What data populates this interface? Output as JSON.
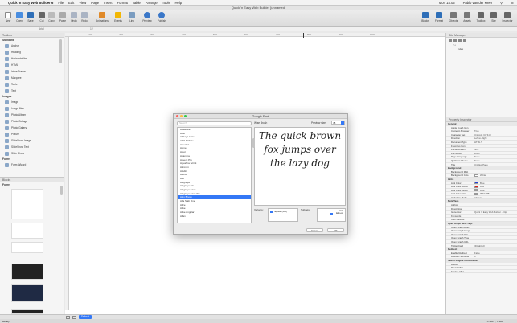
{
  "menubar": {
    "app_name": "Quick 'n Easy Web Builder 6",
    "items": [
      "File",
      "Edit",
      "View",
      "Page",
      "Insert",
      "Format",
      "Table",
      "Arrange",
      "Tools",
      "Help"
    ],
    "clock": "Mon 14:05",
    "user": "Pablo van der Meer"
  },
  "window": {
    "title": "Quick 'n Easy Web Builder [unnamed]"
  },
  "toolbar": {
    "left": [
      "New",
      "Open",
      "Save",
      "Cut",
      "Copy",
      "Paste",
      "Undo",
      "Redo",
      "Animations",
      "Events",
      "Link",
      "Preview",
      "Publish"
    ],
    "right": [
      "Blocks",
      "Format",
      "Objects",
      "Assets",
      "Toolbox",
      "Site",
      "Inspector"
    ]
  },
  "formatbar": {
    "font": "Arial",
    "size": "12"
  },
  "toolbox": {
    "header": "Toolbox",
    "groups": [
      {
        "name": "Standard",
        "items": [
          "Anchor",
          "Heading",
          "Horizontal line",
          "HTML",
          "Inline Frame",
          "Marquee",
          "Table",
          "Text"
        ]
      },
      {
        "name": "Images",
        "items": [
          "Image",
          "Image Map",
          "Photo Album",
          "Photo Collage",
          "Photo Gallery",
          "Picture",
          "SlideShow Image",
          "SlideShow Text",
          "Slide Show"
        ]
      },
      {
        "name": "Forms",
        "items": [
          "Form Wizard"
        ]
      }
    ]
  },
  "blocks": {
    "header": "Blocks",
    "group": "Forms"
  },
  "ruler": [
    "100",
    "200",
    "300",
    "400",
    "500",
    "600",
    "700",
    "800",
    "900",
    "1000"
  ],
  "site_manager": {
    "header": "Site Manager",
    "pages": [
      "index"
    ]
  },
  "inspector": {
    "header": "Property Inspector",
    "rows": [
      {
        "cat": "General"
      },
      {
        "k": "Apple Touch Icon",
        "v": ""
      },
      {
        "k": "Center in Browser",
        "v": "True"
      },
      {
        "k": "Character Set",
        "v": "Unicode (UTF-8)"
      },
      {
        "k": "Direction",
        "v": "Left-to-Right"
      },
      {
        "k": "Document Type",
        "v": "HTML 5"
      },
      {
        "k": "Favorites Icon",
        "v": ""
      },
      {
        "k": "File Extension",
        "v": "html"
      },
      {
        "k": "File Name",
        "v": "index"
      },
      {
        "k": "Page Language",
        "v": "None"
      },
      {
        "k": "Quirks or Theme",
        "v": "None"
      },
      {
        "k": "Title",
        "v": "Untitled Page"
      },
      {
        "cat": "Background"
      },
      {
        "k": "Background Mob",
        "v": ""
      },
      {
        "k": "Background Colo",
        "v": "White",
        "swatch": "#ffffff"
      },
      {
        "cat": "Links"
      },
      {
        "k": "Link Color",
        "v": "Blue",
        "swatch": "#1f3fd6"
      },
      {
        "k": "Link Color Active",
        "v": "Red",
        "swatch": "#e0241b"
      },
      {
        "k": "Link Color Hover",
        "v": "Blue",
        "swatch": "#1f3fd6"
      },
      {
        "k": "Link Color Visit",
        "v": "#551A8B",
        "swatch": "#551a8b"
      },
      {
        "k": "Underline Mode",
        "v": "Always"
      },
      {
        "cat": "Meta Tags"
      },
      {
        "k": "Author",
        "v": ""
      },
      {
        "k": "Description",
        "v": ""
      },
      {
        "k": "Generator",
        "v": "Quick 'n Easy Web Builder - http"
      },
      {
        "k": "Keywords",
        "v": ""
      },
      {
        "k": "User Defined",
        "v": ""
      },
      {
        "cat": "Open Graph Meta Tags"
      },
      {
        "k": "Open Graph Desc",
        "v": ""
      },
      {
        "k": "Open Graph Image",
        "v": ""
      },
      {
        "k": "Open Graph Title",
        "v": ""
      },
      {
        "k": "Open Graph Type",
        "v": ""
      },
      {
        "k": "Open Graph URL",
        "v": ""
      },
      {
        "k": "Twitter Card",
        "v": "(Disabled)"
      },
      {
        "cat": "Redirect"
      },
      {
        "k": "Enable Redirect",
        "v": "False"
      },
      {
        "k": "Redirect Seconds",
        "v": "0"
      },
      {
        "cat": "Search Engine Optimization"
      },
      {
        "k": "Robots",
        "v": ""
      },
      {
        "k": "Revisit After",
        "v": ""
      },
      {
        "k": "Expires After",
        "v": ""
      }
    ]
  },
  "bottombar": {
    "layer": "Default"
  },
  "statusbar": {
    "left": "Ready",
    "right": "X:1184 , Y:380"
  },
  "dialog": {
    "title": "Google Font",
    "search_placeholder": "Search",
    "preview_label": "Wise Brush",
    "preview_size_label": "Preview size:",
    "preview_size": "48",
    "preview_text": "The quick brown fox jumps over the lazy dog",
    "variants_label": "Variants:",
    "variant": "regular (400)",
    "subsets_label": "Subsets:",
    "subsets": [
      "latin",
      "latin-ext"
    ],
    "cancel": "Cancel",
    "ok": "OK",
    "fonts": [
      "ABeeZee",
      "Abel",
      "Abhaya Libre",
      "Abril Fatface",
      "Aclonica",
      "Acme",
      "Actor",
      "Adamina",
      "Advent Pro",
      "Aguafina Script",
      "Akronim",
      "Aladin",
      "Aldrich",
      "Alef",
      "Alegreya",
      "Alegreya SC",
      "Alegreya Sans",
      "Alegreya Sans SC",
      "Alex Brush",
      "Alfa Slab One",
      "Alice",
      "Alike",
      "Alike Angular",
      "Allan"
    ],
    "selected_index": 18
  }
}
